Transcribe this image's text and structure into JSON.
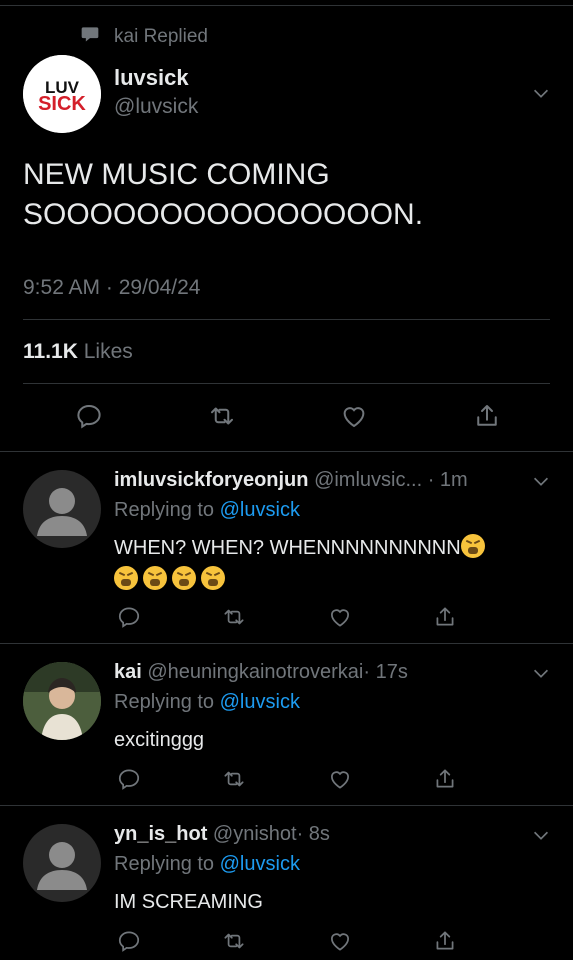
{
  "retweet_context": {
    "text": "kai Replied"
  },
  "main_tweet": {
    "logo_text_top": "LUV",
    "logo_text_bottom": "SICK",
    "display_name": "luvsick",
    "handle": "@luvsick",
    "text": "NEW MUSIC COMING SOOOOOOOOOOOOOOON.",
    "timestamp": "9:52 AM · 29/04/24",
    "likes_count": "11.1K",
    "likes_label": "Likes"
  },
  "replies": [
    {
      "name": "imluvsickforyeonjun",
      "handle": "@imluvsic...",
      "time": "· 1m",
      "replying_prefix": "Replying to",
      "replying_to": "@luvsick",
      "text": "WHEN? WHEN? WHENNNNNNNNNN",
      "emoji_count": 5,
      "emoji_name": "tired-face"
    },
    {
      "name": "kai",
      "handle": "@heuningkainotroverkai",
      "time": "· 17s",
      "replying_prefix": "Replying to",
      "replying_to": "@luvsick",
      "text": "excitinggg"
    },
    {
      "name": "yn_is_hot",
      "handle": "@ynishot",
      "time": "· 8s",
      "replying_prefix": "Replying to",
      "replying_to": "@luvsick",
      "text": "IM SCREAMING"
    }
  ],
  "icons": {
    "reply": "comment-icon",
    "retweet": "retweet-icon",
    "like": "heart-icon",
    "share": "share-icon",
    "more": "chevron-down-icon"
  },
  "colors": {
    "background": "#000000",
    "text": "#e7e9ea",
    "muted": "#71767b",
    "link": "#1d9bf0",
    "divider": "#2f3336"
  }
}
